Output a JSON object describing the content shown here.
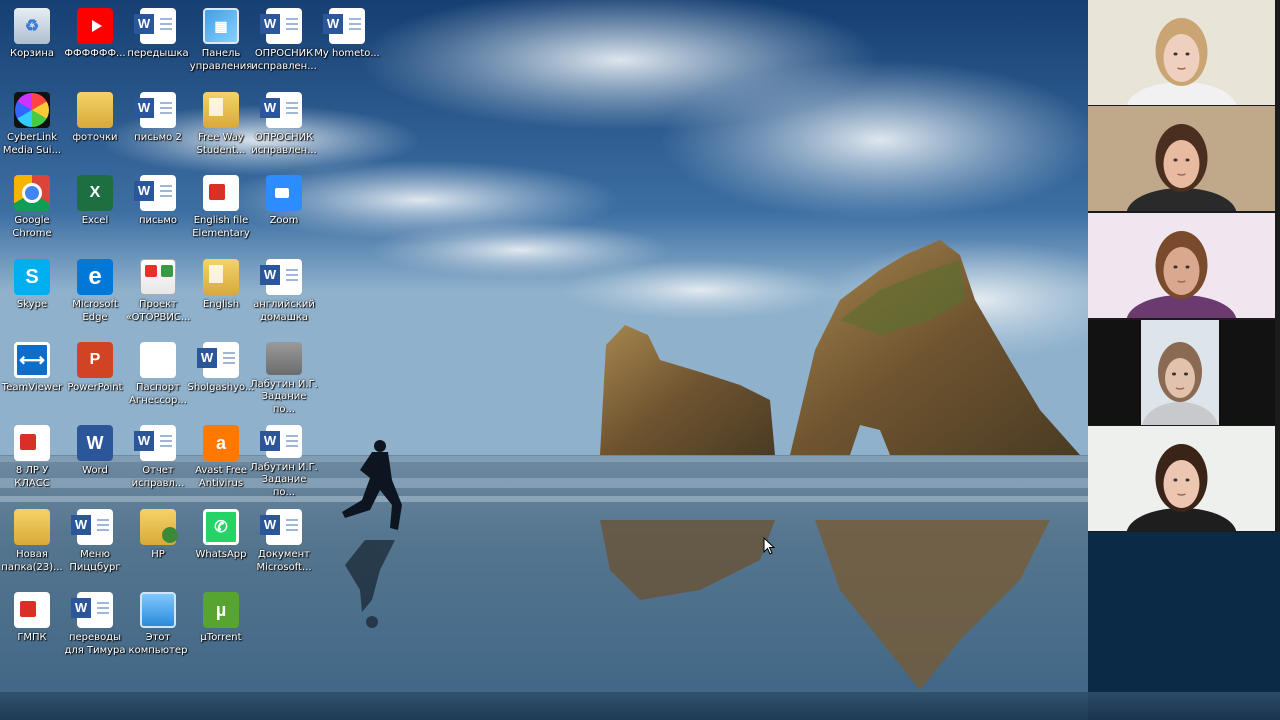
{
  "desktop": {
    "icons": [
      {
        "label": "Корзина",
        "icon": "recycle-bin-icon"
      },
      {
        "label": "ФФФФФФ...",
        "icon": "youtube-icon"
      },
      {
        "label": "передышка",
        "icon": "word-document-icon"
      },
      {
        "label": "Панель управления",
        "icon": "control-panel-icon"
      },
      {
        "label": "ОПРОСНИК исправлен...",
        "icon": "word-document-icon"
      },
      {
        "label": "My hometo...",
        "icon": "word-document-icon"
      },
      {
        "label": "CyberLink Media Sui...",
        "icon": "cyberlink-icon"
      },
      {
        "label": "фоточки",
        "icon": "folder-icon"
      },
      {
        "label": "письмо 2",
        "icon": "word-document-icon"
      },
      {
        "label": "Free Way Student...",
        "icon": "folder-document-icon"
      },
      {
        "label": "ОПРОСНИК исправлен...",
        "icon": "word-document-icon"
      },
      {
        "label": "Google Chrome",
        "icon": "chrome-icon"
      },
      {
        "label": "Excel",
        "icon": "excel-icon"
      },
      {
        "label": "письмо",
        "icon": "word-document-icon"
      },
      {
        "label": "English file Elementary",
        "icon": "pdf-document-icon"
      },
      {
        "label": "Zoom",
        "icon": "zoom-icon"
      },
      {
        "label": "Skype",
        "icon": "skype-icon"
      },
      {
        "label": "Microsoft Edge",
        "icon": "edge-icon"
      },
      {
        "label": "Проект «ОТОРВИС...",
        "icon": "project-icon"
      },
      {
        "label": "English",
        "icon": "folder-document-icon"
      },
      {
        "label": "английский домашка",
        "icon": "word-document-icon"
      },
      {
        "label": "TeamViewer",
        "icon": "teamviewer-icon"
      },
      {
        "label": "PowerPoint",
        "icon": "powerpoint-icon"
      },
      {
        "label": "Паспорт Агнессор...",
        "icon": "pdf-icon"
      },
      {
        "label": "Sholgashyo...",
        "icon": "word-document-icon"
      },
      {
        "label": "Лабутин И.Г. Задание по...",
        "icon": "scan-document-icon"
      },
      {
        "label": "8 ЛР У КЛАСС",
        "icon": "pdf-document-icon"
      },
      {
        "label": "Word",
        "icon": "word-app-icon"
      },
      {
        "label": "Отчет исправл...",
        "icon": "word-document-icon"
      },
      {
        "label": "Avast Free Antivirus",
        "icon": "avast-icon"
      },
      {
        "label": "Лабутин И.Г. Задание по...",
        "icon": "word-document-icon"
      },
      {
        "label": "Новая папка(23)...",
        "icon": "folder-icon"
      },
      {
        "label": "Меню Пиццбург",
        "icon": "word-document-icon"
      },
      {
        "label": "HP",
        "icon": "hp-folder-icon"
      },
      {
        "label": "WhatsApp",
        "icon": "whatsapp-icon"
      },
      {
        "label": "Документ Microsoft...",
        "icon": "word-document-icon"
      },
      {
        "label": "ГМПК",
        "icon": "pdf-document-icon"
      },
      {
        "label": "переводы для Тимура",
        "icon": "word-document-icon"
      },
      {
        "label": "Этот компьютер",
        "icon": "this-pc-icon"
      },
      {
        "label": "µTorrent",
        "icon": "utorrent-icon"
      }
    ]
  },
  "zoom": {
    "participants": [
      {
        "name": "participant-1",
        "wall": "#e9e4d8",
        "hair": "#c9a574",
        "shirt": "#f1f1f1",
        "skin": "#efcfbd"
      },
      {
        "name": "participant-2",
        "wall": "#bfa98a",
        "hair": "#4a2e20",
        "shirt": "#2a2a2a",
        "skin": "#e8bba1"
      },
      {
        "name": "participant-3",
        "wall": "#efe6ef",
        "hair": "#7a4a2c",
        "shirt": "#6b3a6e",
        "skin": "#d9a88e"
      },
      {
        "name": "participant-4",
        "wall": "#dde4ea",
        "hair": "#8a6a52",
        "shirt": "#c8c9cc",
        "skin": "#e3c2ad"
      },
      {
        "name": "participant-5",
        "wall": "#eef0ee",
        "hair": "#3a2418",
        "shirt": "#1e1e1e",
        "skin": "#edc6b1"
      }
    ]
  },
  "colors": {
    "sky_top": "#1f4e86",
    "sky_mid": "#5e8fbd",
    "sea": "#4f6f8b",
    "sand": "#6a8aa6",
    "rock": "#8a6a3a",
    "word_blue": "#2b579a"
  }
}
